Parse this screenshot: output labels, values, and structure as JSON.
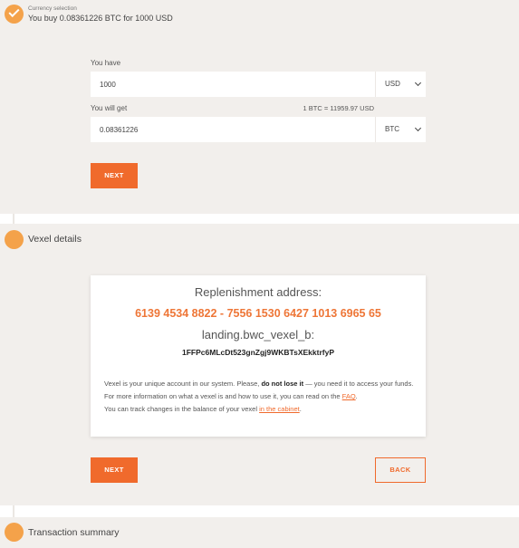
{
  "steps": {
    "currency": {
      "subtitle": "Currency selection",
      "summary": "You buy 0.08361226 BTC for 1000 USD"
    },
    "vexel": {
      "title": "Vexel details"
    },
    "summary": {
      "title": "Transaction summary"
    }
  },
  "exchange": {
    "have_label": "You have",
    "have_value": "1000",
    "have_currency": "USD",
    "get_label": "You will get",
    "rate": "1 BTC = 11959.97 USD",
    "get_value": "0.08361226",
    "get_currency": "BTC",
    "next_label": "NEXT"
  },
  "vexel_card": {
    "replenishment_title": "Replenishment address:",
    "vexel_number": "6139 4534 8822 - 7556 1530 6427 1013 6965 65",
    "wallet_label": "landing.bwc_vexel_b:",
    "wallet_address": "1FFPc6MLcDt523gnZgj9WKBTsXEkktrfyP",
    "info_part1": "Vexel is your unique account in our system. Please, ",
    "info_bold": "do not lose it",
    "info_part2": " — you need it to access your funds. For more information on what a vexel is and how to use it, you can read on the ",
    "faq_link": "FAQ",
    "info_part3": ".",
    "track_text": "You can track changes in the balance of your vexel ",
    "cabinet_link": "in the cabinet",
    "track_end": "."
  },
  "vexel_actions": {
    "next_label": "NEXT",
    "back_label": "BACK"
  },
  "colors": {
    "accent": "#f06a2c",
    "step_circle": "#f4a24a",
    "panel_bg": "#f2efec"
  }
}
